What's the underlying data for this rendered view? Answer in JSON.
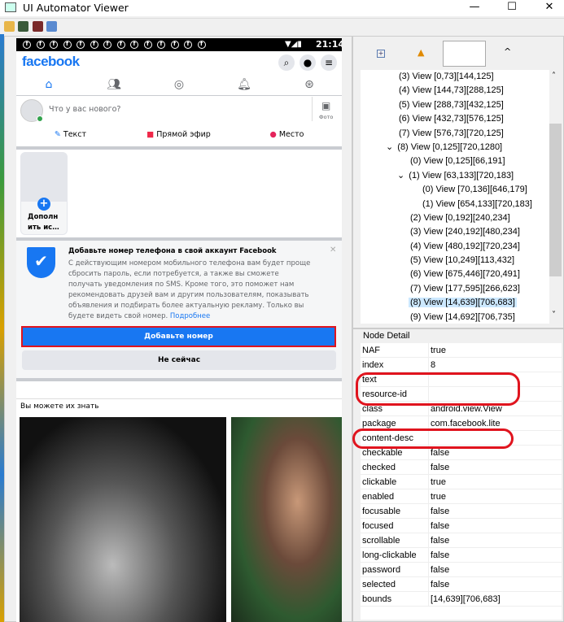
{
  "window": {
    "title": "UI Automator Viewer",
    "min": "—",
    "max": "☐",
    "close": "✕"
  },
  "phone": {
    "time": "21:14",
    "logo": "facebook",
    "composer_placeholder": "Что у вас нового?",
    "photo_label": "Фото",
    "actions": [
      "Текст",
      "Прямой эфир",
      "Место"
    ],
    "story_label": "Дополн ить ис…",
    "card": {
      "title": "Добавьте номер телефона в свой аккаунт Facebook",
      "body": "С действующим номером мобильного телефона вам будет проще сбросить пароль, если потребуется, а также вы сможете получать уведомления по SMS. Кроме того, это поможет нам рекомендовать друзей вам и другим пользователям, показывать объявления и подбирать более актуальную рекламу. Только вы будете видеть свой номер.",
      "link": "Подробнее",
      "primary": "Добавьте номер",
      "secondary": "Не сейчас"
    },
    "pymk": "Вы можете их знать"
  },
  "tree": {
    "items": [
      {
        "label": "(3) View [0,73][144,125]",
        "level": 1
      },
      {
        "label": "(4) View [144,73][288,125]",
        "level": 1
      },
      {
        "label": "(5) View [288,73][432,125]",
        "level": 1
      },
      {
        "label": "(6) View [432,73][576,125]",
        "level": 1
      },
      {
        "label": "(7) View [576,73][720,125]",
        "level": 1
      },
      {
        "label": "(8) View [0,125][720,1280]",
        "level": 1,
        "expanded": true
      },
      {
        "label": "(0) View [0,125][66,191]",
        "level": 2
      },
      {
        "label": "(1) View [63,133][720,183]",
        "level": 2,
        "expanded": true
      },
      {
        "label": "(0) View [70,136][646,179]",
        "level": 3
      },
      {
        "label": "(1) View [654,133][720,183]",
        "level": 3
      },
      {
        "label": "(2) View [0,192][240,234]",
        "level": 2
      },
      {
        "label": "(3) View [240,192][480,234]",
        "level": 2
      },
      {
        "label": "(4) View [480,192][720,234]",
        "level": 2
      },
      {
        "label": "(5) View [10,249][113,432]",
        "level": 2
      },
      {
        "label": "(6) View [675,446][720,491]",
        "level": 2
      },
      {
        "label": "(7) View [177,595][266,623]",
        "level": 2
      },
      {
        "label": "(8) View [14,639][706,683]",
        "level": 2,
        "selected": true
      },
      {
        "label": "(9) View [14,692][706,735]",
        "level": 2
      }
    ]
  },
  "detail": {
    "title": "Node Detail",
    "rows": [
      [
        "NAF",
        "true"
      ],
      [
        "index",
        "8"
      ],
      [
        "text",
        ""
      ],
      [
        "resource-id",
        ""
      ],
      [
        "class",
        "android.view.View"
      ],
      [
        "package",
        "com.facebook.lite"
      ],
      [
        "content-desc",
        ""
      ],
      [
        "checkable",
        "false"
      ],
      [
        "checked",
        "false"
      ],
      [
        "clickable",
        "true"
      ],
      [
        "enabled",
        "true"
      ],
      [
        "focusable",
        "false"
      ],
      [
        "focused",
        "false"
      ],
      [
        "scrollable",
        "false"
      ],
      [
        "long-clickable",
        "false"
      ],
      [
        "password",
        "false"
      ],
      [
        "selected",
        "false"
      ],
      [
        "bounds",
        "[14,639][706,683]"
      ]
    ]
  },
  "colors": {
    "fb_blue": "#1877f2",
    "highlight": "#e0141e",
    "selection": "#cce8ff"
  }
}
